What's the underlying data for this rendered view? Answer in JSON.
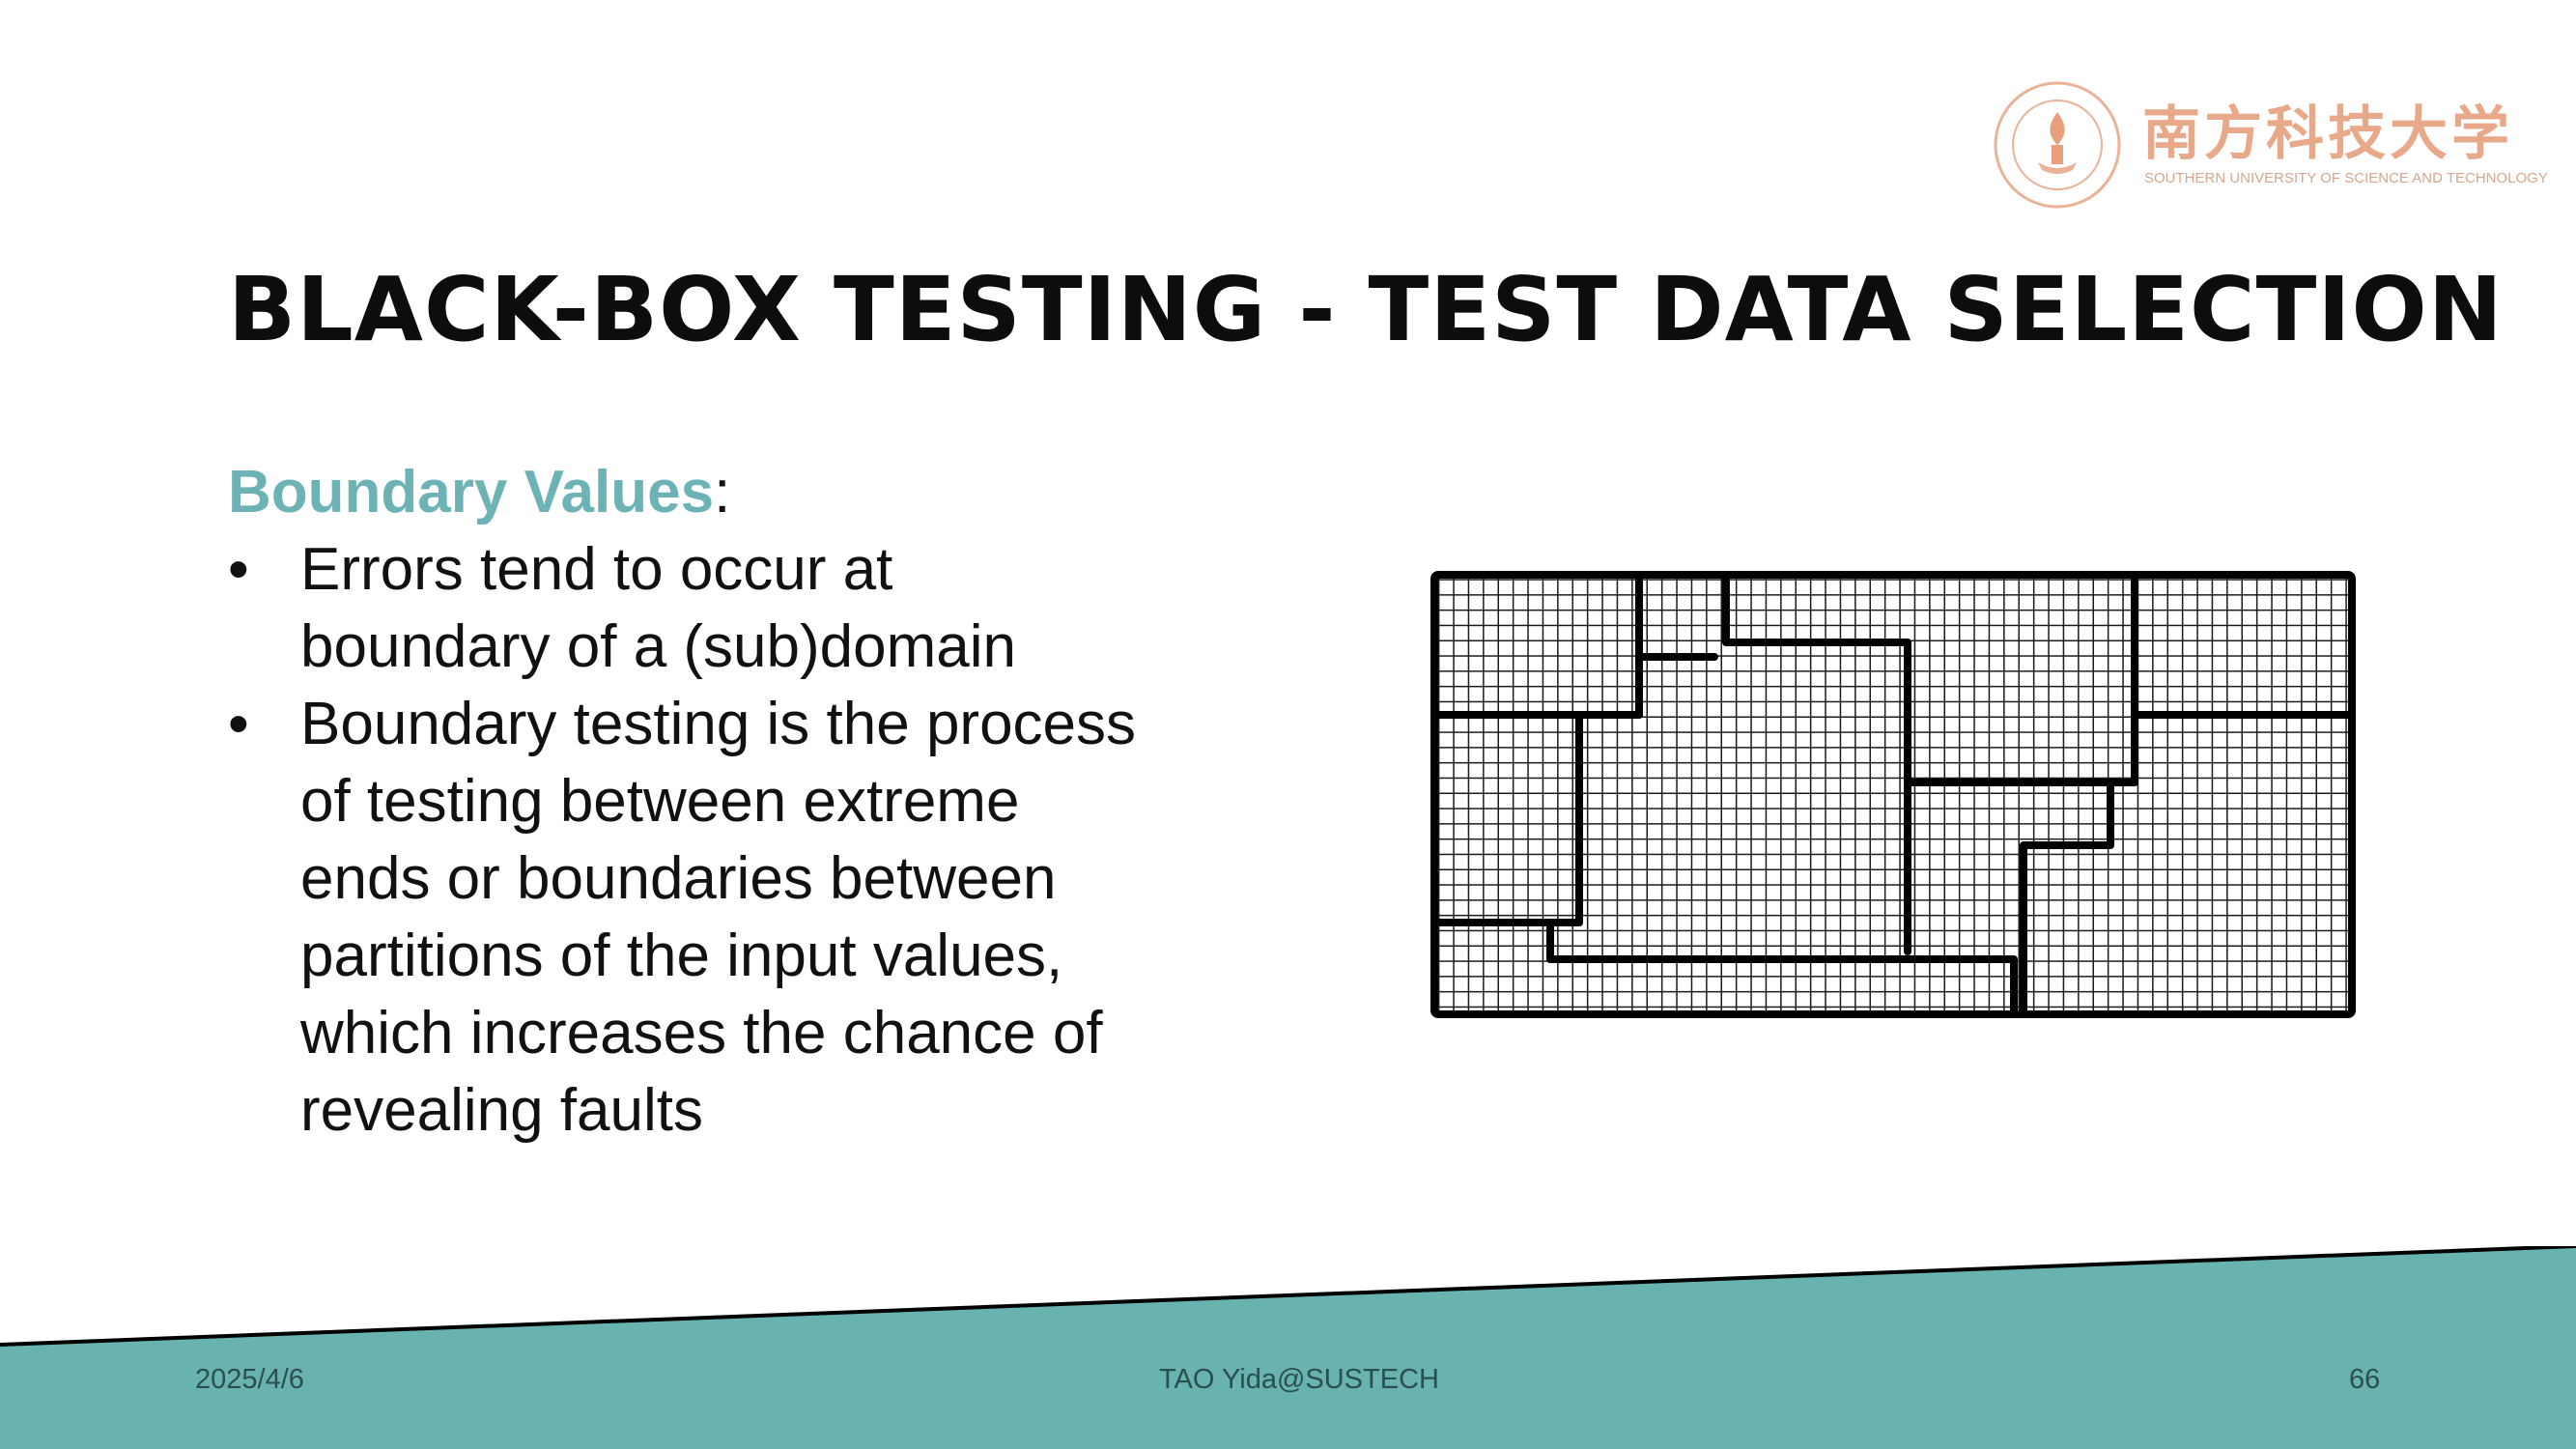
{
  "logo": {
    "name_cn": "南方科技大学",
    "name_en": "SOUTHERN UNIVERSITY OF SCIENCE AND TECHNOLOGY"
  },
  "title": "BLACK-BOX TESTING - TEST DATA SELECTION",
  "heading": {
    "strong": "Boundary Values",
    "suffix": ":"
  },
  "bullets": [
    {
      "mark": "•",
      "lines": [
        "Errors tend to occur at",
        "boundary of a (sub)domain"
      ]
    },
    {
      "mark": "•",
      "lines": [
        "Boundary testing is the process",
        "of testing between extreme",
        "ends or boundaries between",
        "partitions of the input values,",
        "which increases the chance of",
        "revealing faults"
      ]
    }
  ],
  "footer": {
    "date": "2025/4/6",
    "author": "TAO Yida@SUSTECH",
    "page": "66"
  },
  "colors": {
    "accent": "#6db3b5",
    "footer_band": "#68b2b0",
    "logo": "#e8a98a"
  }
}
